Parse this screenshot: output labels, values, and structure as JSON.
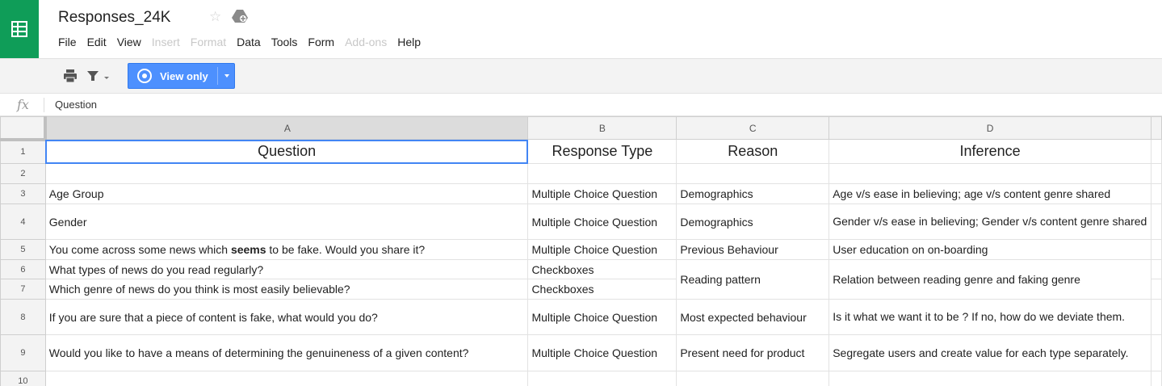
{
  "app": {
    "title": "Responses_24K",
    "brand_color": "#0f9d58",
    "star_icon": "star-outline-icon",
    "drive_icon": "shared-drive-icon"
  },
  "menu": {
    "items": [
      {
        "label": "File",
        "enabled": true
      },
      {
        "label": "Edit",
        "enabled": true
      },
      {
        "label": "View",
        "enabled": true
      },
      {
        "label": "Insert",
        "enabled": false
      },
      {
        "label": "Format",
        "enabled": false
      },
      {
        "label": "Data",
        "enabled": true
      },
      {
        "label": "Tools",
        "enabled": true
      },
      {
        "label": "Form",
        "enabled": true
      },
      {
        "label": "Add-ons",
        "enabled": false
      },
      {
        "label": "Help",
        "enabled": true
      }
    ]
  },
  "toolbar": {
    "print_icon": "print-icon",
    "filter_icon": "filter-icon",
    "view_only_label": "View only",
    "view_only_color": "#4d90fe"
  },
  "formula_bar": {
    "fx_label": "fx",
    "content": "Question"
  },
  "sheet": {
    "columns": [
      "A",
      "B",
      "C",
      "D"
    ],
    "row_numbers": [
      "1",
      "2",
      "3",
      "4",
      "5",
      "6",
      "7",
      "8",
      "9",
      "10"
    ],
    "header": {
      "question": "Question",
      "response_type": "Response Type",
      "reason": "Reason",
      "inference": "Inference"
    },
    "rows": {
      "r3": {
        "a": "Age Group",
        "b": "Multiple Choice Question",
        "c": "Demographics",
        "d": "Age v/s ease in believing; age v/s content genre shared"
      },
      "r4": {
        "a": "Gender",
        "b": "Multiple Choice Question",
        "c": "Demographics",
        "d": "Gender v/s ease in believing; Gender v/s content genre shared"
      },
      "r5": {
        "a_pre": "You come across some news which ",
        "a_bold": "seems",
        "a_post": " to be fake. Would you share it?",
        "b": "Multiple Choice Question",
        "c": "Previous Behaviour",
        "d": "User education on on-boarding"
      },
      "r6": {
        "a": "What types of news do you read regularly?",
        "b": "Checkboxes",
        "c": "Reading pattern",
        "d": "Relation between reading genre and faking genre"
      },
      "r7": {
        "a": "Which genre of news do you think is most easily believable?",
        "b": "Checkboxes"
      },
      "r8": {
        "a": "If you are sure that a piece of content is fake, what would you do?",
        "b": "Multiple Choice Question",
        "c": "Most expected behaviour",
        "d": "Is it what we want it to be ? If no, how do we deviate them."
      },
      "r9": {
        "a": "Would you like to have a means of determining the genuineness of a given content?",
        "b": "Multiple Choice Question",
        "c": "Present need for product",
        "d": "Segregate users and create value for each type separately."
      }
    }
  }
}
